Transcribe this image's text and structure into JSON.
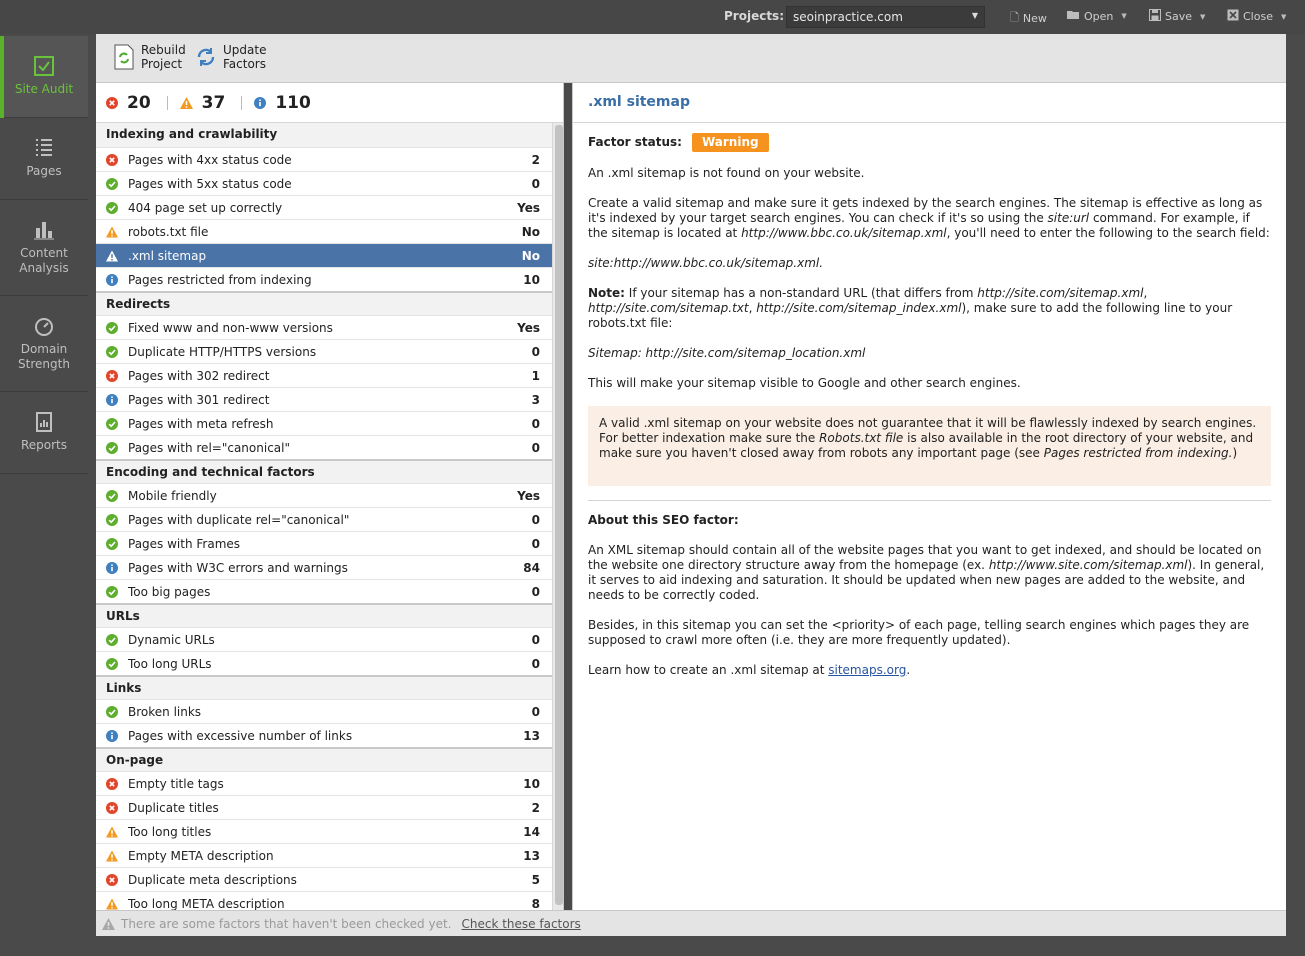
{
  "topbar": {
    "projects_label": "Projects:",
    "project_selected": "seoinpractice.com",
    "new_label": "New",
    "open_label": "Open",
    "save_label": "Save",
    "close_label": "Close"
  },
  "nav": {
    "items": [
      {
        "label": "Site Audit",
        "icon": "checkbox-icon",
        "active": true
      },
      {
        "label": "Pages",
        "icon": "list-icon"
      },
      {
        "label": "Content Analysis",
        "icon": "bar-chart-icon"
      },
      {
        "label": "Domain Strength",
        "icon": "gauge-icon"
      },
      {
        "label": "Reports",
        "icon": "report-icon"
      }
    ]
  },
  "toolbar": {
    "rebuild_label": "Rebuild\nProject",
    "update_label": "Update\nFactors"
  },
  "summary": {
    "errors": "20",
    "warnings": "37",
    "info": "110"
  },
  "groups": [
    {
      "title": "Indexing and crawlability",
      "rows": [
        {
          "status": "error",
          "label": "Pages with 4xx status code",
          "value": "2"
        },
        {
          "status": "ok",
          "label": "Pages with 5xx status code",
          "value": "0"
        },
        {
          "status": "ok",
          "label": "404 page set up correctly",
          "value": "Yes"
        },
        {
          "status": "warning",
          "label": "robots.txt file",
          "value": "No"
        },
        {
          "status": "warning",
          "label": ".xml sitemap",
          "value": "No",
          "selected": true
        },
        {
          "status": "info",
          "label": "Pages restricted from indexing",
          "value": "10"
        }
      ]
    },
    {
      "title": "Redirects",
      "rows": [
        {
          "status": "ok",
          "label": "Fixed www and non-www versions",
          "value": "Yes"
        },
        {
          "status": "ok",
          "label": "Duplicate HTTP/HTTPS versions",
          "value": "0"
        },
        {
          "status": "error",
          "label": "Pages with 302 redirect",
          "value": "1"
        },
        {
          "status": "info",
          "label": "Pages with 301 redirect",
          "value": "3"
        },
        {
          "status": "ok",
          "label": "Pages with meta refresh",
          "value": "0"
        },
        {
          "status": "ok",
          "label": "Pages with rel=\"canonical\"",
          "value": "0"
        }
      ]
    },
    {
      "title": "Encoding and technical factors",
      "rows": [
        {
          "status": "ok",
          "label": "Mobile friendly",
          "value": "Yes"
        },
        {
          "status": "ok",
          "label": "Pages with duplicate rel=\"canonical\"",
          "value": "0"
        },
        {
          "status": "ok",
          "label": "Pages with Frames",
          "value": "0"
        },
        {
          "status": "info",
          "label": "Pages with W3C errors and warnings",
          "value": "84"
        },
        {
          "status": "ok",
          "label": "Too big pages",
          "value": "0"
        }
      ]
    },
    {
      "title": "URLs",
      "rows": [
        {
          "status": "ok",
          "label": "Dynamic URLs",
          "value": "0"
        },
        {
          "status": "ok",
          "label": "Too long URLs",
          "value": "0"
        }
      ]
    },
    {
      "title": "Links",
      "rows": [
        {
          "status": "ok",
          "label": "Broken links",
          "value": "0"
        },
        {
          "status": "info",
          "label": "Pages with excessive number of links",
          "value": "13"
        }
      ]
    },
    {
      "title": "On-page",
      "rows": [
        {
          "status": "error",
          "label": "Empty title tags",
          "value": "10"
        },
        {
          "status": "error",
          "label": "Duplicate titles",
          "value": "2"
        },
        {
          "status": "warning",
          "label": "Too long titles",
          "value": "14"
        },
        {
          "status": "warning",
          "label": "Empty META description",
          "value": "13"
        },
        {
          "status": "error",
          "label": "Duplicate meta descriptions",
          "value": "5"
        },
        {
          "status": "warning",
          "label": "Too long META description",
          "value": "8"
        }
      ]
    }
  ],
  "detail": {
    "title": ".xml sitemap",
    "factor_status_label": "Factor status:",
    "factor_status_value": "Warning",
    "p1": "An .xml sitemap is not found on your website.",
    "p2_a": "Create a valid sitemap and make sure it gets indexed by the search engines. The sitemap is effective as long as it's indexed by your target search engines. You can check if it's so using the ",
    "p2_b": "site:url",
    "p2_c": " command. For example, if the sitemap is located at ",
    "p2_d": "http://www.bbc.co.uk/sitemap.xml",
    "p2_e": ", you'll need to enter the following to the search field:",
    "p3": "site:http://www.bbc.co.uk/sitemap.xml.",
    "p4_note": "Note:",
    "p4_a": " If your sitemap has a non-standard URL (that differs from ",
    "p4_b": "http://site.com/sitemap.xml",
    "p4_c": ", ",
    "p4_d": "http://site.com/sitemap.txt",
    "p4_e": ", ",
    "p4_f": "http://site.com/sitemap_index.xml",
    "p4_g": "), make sure to add the following line to your robots.txt file:",
    "p5": "Sitemap: http://site.com/sitemap_location.xml",
    "p6": "This will make your sitemap visible to Google and other search engines.",
    "note_a": "A valid .xml sitemap on your website does not guarantee that it will be flawlessly indexed by search engines. For better indexation make sure the ",
    "note_b": "Robots.txt file",
    "note_c": " is also available in the root directory of your website, and make sure you haven't closed away from robots any important page (see ",
    "note_d": "Pages restricted from indexing.",
    "note_e": ")",
    "about_title": "About this SEO factor:",
    "a1_a": "An XML sitemap should contain all of the website pages that you want to get indexed, and should be located on the website one directory structure away from the homepage (ex. ",
    "a1_b": "http://www.site.com/sitemap.xml",
    "a1_c": "). In general, it serves to aid indexing and saturation. It should be updated when new pages are added to the website, and needs to be correctly coded.",
    "a2": "Besides, in this sitemap you can set the <priority> of each page, telling search engines which pages they are supposed to crawl more often (i.e. they are more frequently updated).",
    "a3_a": "Learn how to create an .xml sitemap at ",
    "a3_link": "sitemaps.org",
    "a3_b": "."
  },
  "footer": {
    "message": "There are some factors that haven't been checked yet.",
    "link": "Check these factors"
  },
  "colors": {
    "error": "#e0452a",
    "warning": "#f19a1f",
    "ok": "#5fae2f",
    "info": "#3f7fc0",
    "accent": "#5ab22a",
    "selected_row": "#4a73a8"
  }
}
